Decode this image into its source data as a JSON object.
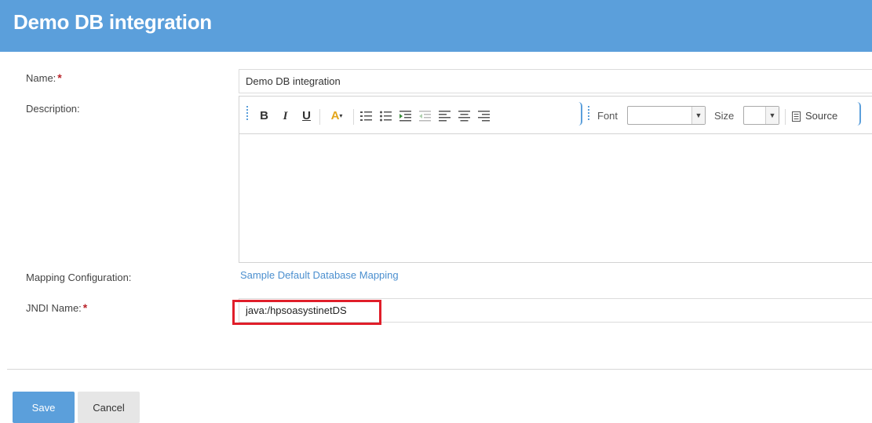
{
  "header": {
    "title": "Demo DB integration"
  },
  "form": {
    "name_label": "Name:",
    "required_mark": "*",
    "name_value": "Demo DB integration",
    "description_label": "Description:",
    "mapping_label": "Mapping Configuration:",
    "mapping_link": "Sample Default Database Mapping",
    "jndi_label": "JNDI Name:",
    "jndi_value": "java:/hpsoasystinetDS"
  },
  "toolbar": {
    "bold": "B",
    "italic": "I",
    "underline": "U",
    "text_color": "A",
    "font_label": "Font",
    "size_label": "Size",
    "source_label": "Source"
  },
  "actions": {
    "save": "Save",
    "cancel": "Cancel"
  },
  "colors": {
    "header": "#5b9fdb",
    "link": "#4b8fcf",
    "required": "#b9232a",
    "highlight": "#e01e2a"
  }
}
